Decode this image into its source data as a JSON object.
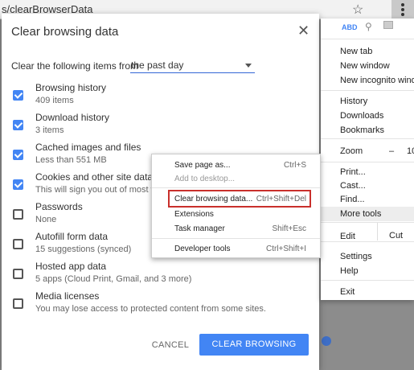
{
  "browser": {
    "url": "s/clearBrowserData"
  },
  "dialog": {
    "title": "Clear browsing data",
    "range_label": "Clear the following items from",
    "range_value": "the past day",
    "items": [
      {
        "title": "Browsing history",
        "subtitle": "409 items",
        "checked": true
      },
      {
        "title": "Download history",
        "subtitle": "3 items",
        "checked": true
      },
      {
        "title": "Cached images and files",
        "subtitle": "Less than 551 MB",
        "checked": true
      },
      {
        "title": "Cookies and other site data",
        "subtitle": "This will sign you out of most we",
        "checked": true
      },
      {
        "title": "Passwords",
        "subtitle": "None",
        "checked": false
      },
      {
        "title": "Autofill form data",
        "subtitle": "15 suggestions (synced)",
        "checked": false
      },
      {
        "title": "Hosted app data",
        "subtitle": "5 apps (Cloud Print, Gmail, and 3 more)",
        "checked": false
      },
      {
        "title": "Media licenses",
        "subtitle": "You may lose access to protected content from some sites.",
        "checked": false
      }
    ],
    "cancel_label": "CANCEL",
    "confirm_label": "CLEAR BROWSING DATA",
    "accent_color": "#4285f4"
  },
  "chrome_menu": {
    "extensions": {
      "e1": "ABD"
    },
    "new_tab": "New tab",
    "new_window": "New window",
    "new_incognito": "New incognito window",
    "history": "History",
    "downloads": "Downloads",
    "bookmarks": "Bookmarks",
    "zoom_label": "Zoom",
    "zoom_minus": "–",
    "zoom_value": "10",
    "print": "Print...",
    "cast": "Cast...",
    "find": "Find...",
    "more_tools": "More tools",
    "edit": "Edit",
    "cut": "Cut",
    "settings": "Settings",
    "help": "Help",
    "exit": "Exit"
  },
  "context_menu": {
    "items": [
      {
        "label": "Save page as...",
        "shortcut": "Ctrl+S",
        "disabled": false
      },
      {
        "label": "Add to desktop...",
        "shortcut": "",
        "disabled": true
      },
      {
        "label": "Clear browsing data...",
        "shortcut": "Ctrl+Shift+Del",
        "disabled": false
      },
      {
        "label": "Extensions",
        "shortcut": "",
        "disabled": false
      },
      {
        "label": "Task manager",
        "shortcut": "Shift+Esc",
        "disabled": false
      },
      {
        "label": "Developer tools",
        "shortcut": "Ctrl+Shift+I",
        "disabled": false
      }
    ],
    "highlight_color": "#c9302c"
  }
}
